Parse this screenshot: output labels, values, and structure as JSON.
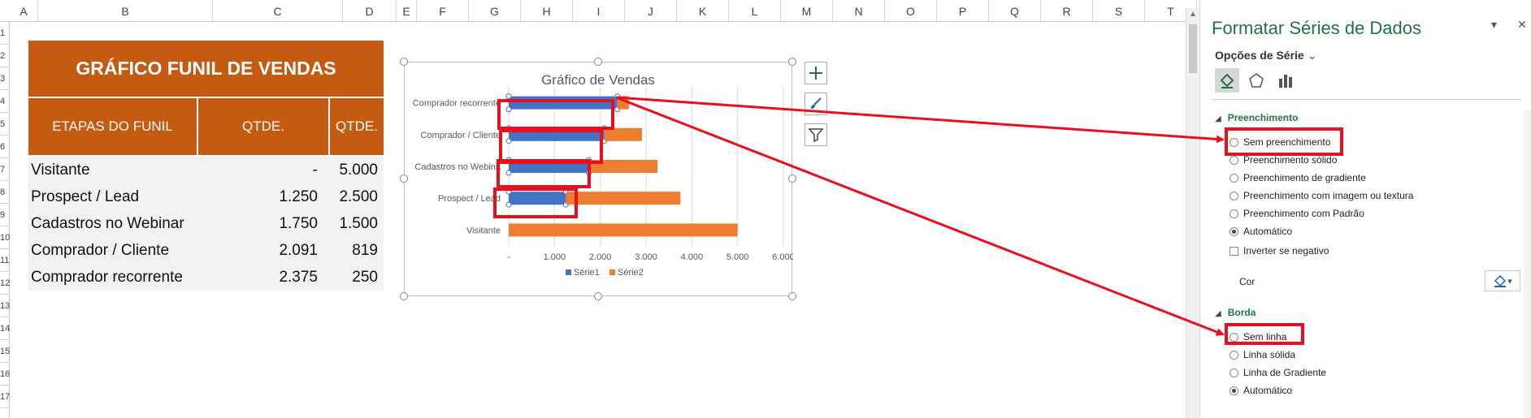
{
  "sheet": {
    "columns": [
      "A",
      "B",
      "C",
      "D",
      "E",
      "F",
      "G",
      "H",
      "I",
      "J",
      "K",
      "L",
      "M",
      "N",
      "O",
      "P",
      "Q",
      "R",
      "S",
      "T"
    ],
    "rows": [
      "1",
      "2",
      "3",
      "4",
      "5",
      "6",
      "7",
      "8",
      "9",
      "10",
      "11",
      "12",
      "13",
      "14",
      "15",
      "16",
      "17"
    ],
    "table": {
      "title": "GRÁFICO FUNIL DE VENDAS",
      "headers": [
        "ETAPAS DO FUNIL",
        "QTDE.",
        "QTDE."
      ],
      "rows": [
        {
          "etapa": "Visitante",
          "q1": "-",
          "q2": "5.000"
        },
        {
          "etapa": "Prospect / Lead",
          "q1": "1.250",
          "q2": "2.500"
        },
        {
          "etapa": "Cadastros no Webinar",
          "q1": "1.750",
          "q2": "1.500"
        },
        {
          "etapa": "Comprador / Cliente",
          "q1": "2.091",
          "q2": "819"
        },
        {
          "etapa": "Comprador recorrente",
          "q1": "2.375",
          "q2": "250"
        }
      ]
    }
  },
  "chart_data": {
    "type": "bar",
    "orientation": "horizontal",
    "stacked": true,
    "title": "Gráfico de Vendas",
    "categories": [
      "Visitante",
      "Prospect / Lead",
      "Cadastros no Webinar",
      "Comprador / Cliente",
      "Comprador recorrente"
    ],
    "category_labels_shown": [
      "Visitante",
      "Prospect / Lead",
      "Cadastros no Webina",
      "Comprador / Cliente",
      "Comprador recorrente"
    ],
    "series": [
      {
        "name": "Série1",
        "color": "#4472c4",
        "values": [
          0,
          1250,
          1750,
          2091,
          2375
        ]
      },
      {
        "name": "Série2",
        "color": "#ed7d31",
        "values": [
          5000,
          2500,
          1500,
          819,
          250
        ]
      }
    ],
    "xlim": [
      0,
      6000
    ],
    "xticks": [
      "-",
      "1.000",
      "2.000",
      "3.000",
      "4.000",
      "5.000",
      "6.000"
    ],
    "grid": true,
    "legend": "bottom"
  },
  "chart_buttons": [
    "plus-icon",
    "brush-icon",
    "filter-icon"
  ],
  "pane": {
    "title": "Formatar Séries de Dados",
    "options_label": "Opções de Série",
    "fill_section": "Preenchimento",
    "fill_options": [
      {
        "label": "Sem preenchimento",
        "selected": false
      },
      {
        "label": "Preenchimento sólido",
        "selected": false
      },
      {
        "label": "Preenchimento de gradiente",
        "selected": false
      },
      {
        "label": "Preenchimento com imagem ou textura",
        "selected": false
      },
      {
        "label": "Preenchimento com Padrão",
        "selected": false
      },
      {
        "label": "Automático",
        "selected": true
      }
    ],
    "invert_label": "Inverter se negativo",
    "color_label": "Cor",
    "border_section": "Borda",
    "border_options": [
      {
        "label": "Sem linha",
        "selected": false
      },
      {
        "label": "Linha sólida",
        "selected": false
      },
      {
        "label": "Linha de Gradiente",
        "selected": false
      },
      {
        "label": "Automático",
        "selected": true
      }
    ],
    "accent_color": "#217346",
    "annotation_color": "#e8101e"
  }
}
